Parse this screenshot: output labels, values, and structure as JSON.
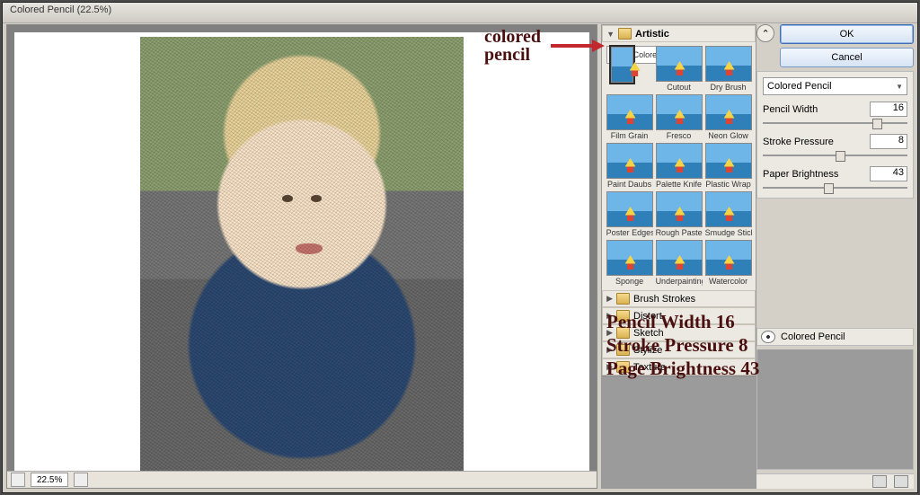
{
  "title": "Colored Pencil (22.5%)",
  "zoom": "22.5%",
  "buttons": {
    "ok": "OK",
    "cancel": "Cancel"
  },
  "dropdown": {
    "selected": "Colored Pencil"
  },
  "params": {
    "pencil_width": {
      "label": "Pencil Width",
      "value": "16",
      "pos": 76
    },
    "stroke_pressure": {
      "label": "Stroke Pressure",
      "value": "8",
      "pos": 50
    },
    "paper_bright": {
      "label": "Paper Brightness",
      "value": "43",
      "pos": 42
    }
  },
  "stack_label": "Colored Pencil",
  "categories": {
    "artistic": "Artistic",
    "brush": "Brush Strokes",
    "distort": "Distort",
    "sketch": "Sketch",
    "stylize": "Stylize",
    "texture": "Texture"
  },
  "filters": {
    "colored_pencil": "Colored Pencil",
    "cutout": "Cutout",
    "dry_brush": "Dry Brush",
    "film_grain": "Film Grain",
    "fresco": "Fresco",
    "neon_glow": "Neon Glow",
    "paint_daubs": "Paint Daubs",
    "palette_knife": "Palette Knife",
    "plastic_wrap": "Plastic Wrap",
    "poster_edges": "Poster Edges",
    "rough_pastels": "Rough Pastels",
    "smudge_stick": "Smudge Stick",
    "sponge": "Sponge",
    "underpainting": "Underpainting",
    "watercolor": "Watercolor"
  },
  "annot": {
    "lbl1": "colored",
    "lbl2": "pencil",
    "line1": "Pencil Width 16",
    "line2": "Stroke Pressure 8",
    "line3": "Page Brightness 43"
  }
}
